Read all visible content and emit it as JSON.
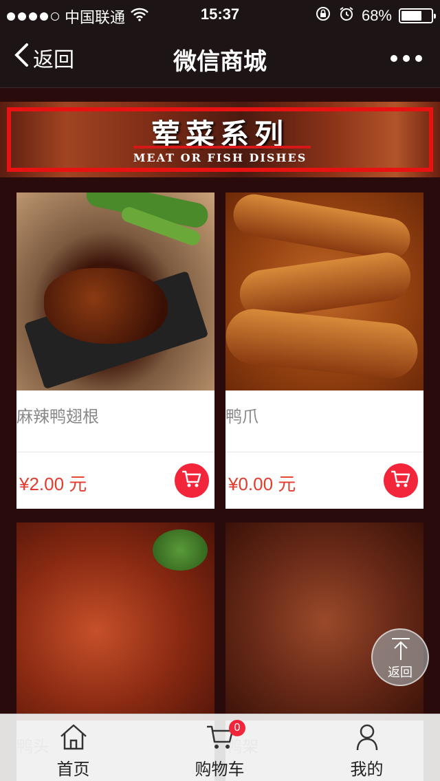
{
  "status_bar": {
    "carrier": "中国联通",
    "time": "15:37",
    "battery_percent": "68%",
    "battery_level": 0.68,
    "signal_bars": 4
  },
  "nav": {
    "back_label": "返回",
    "title": "微信商城"
  },
  "banner": {
    "title": "荤菜系列",
    "subtitle": "MEAT OR FISH DISHES"
  },
  "products": [
    {
      "name": "麻辣鸭翅根",
      "price": "¥2.00 元"
    },
    {
      "name": "鸭爪",
      "price": "¥0.00 元"
    },
    {
      "name": "鸭头"
    },
    {
      "name": "鸭架"
    }
  ],
  "float_button": {
    "label": "返回"
  },
  "tabbar": {
    "home": "首页",
    "cart": "购物车",
    "cart_badge": "0",
    "mine": "我的"
  },
  "colors": {
    "accent": "#f2253a",
    "price": "#e33b2e",
    "background": "#2a0b0c",
    "banner_frame": "#e81212"
  }
}
